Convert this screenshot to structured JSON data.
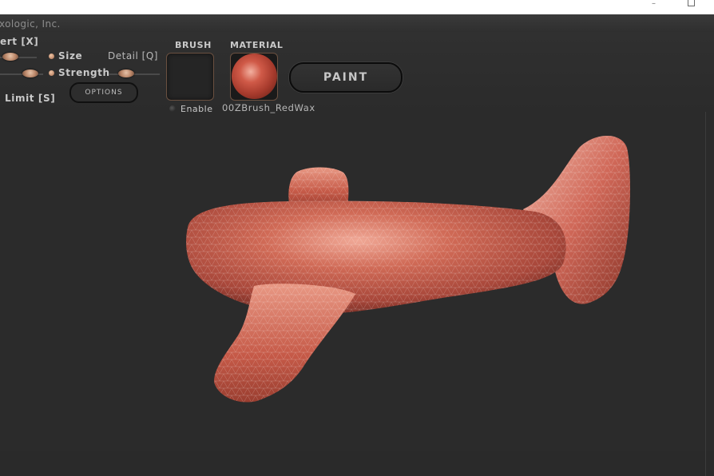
{
  "company": "xologic, Inc.",
  "window": {
    "minimize_glyph": "–"
  },
  "controls": {
    "invert_label": "ert [X]",
    "size_label": "Size",
    "detail_label": "Detail [Q]",
    "strength_label": "Strength",
    "limit_label": "Limit [S]",
    "options_label": "OPTIONS"
  },
  "brush": {
    "header": "BRUSH",
    "enable_label": "Enable"
  },
  "material": {
    "header": "MATERIAL",
    "name": "00ZBrush_RedWax"
  },
  "paint_label": "PAINT",
  "icons": {
    "minimize": "minimize-icon",
    "maximize": "maximize-icon"
  },
  "colors": {
    "wax": "#c65a48",
    "wax_dark": "#7a2a20",
    "wax_light": "#f0b8a8",
    "background": "#2b2b2b"
  }
}
